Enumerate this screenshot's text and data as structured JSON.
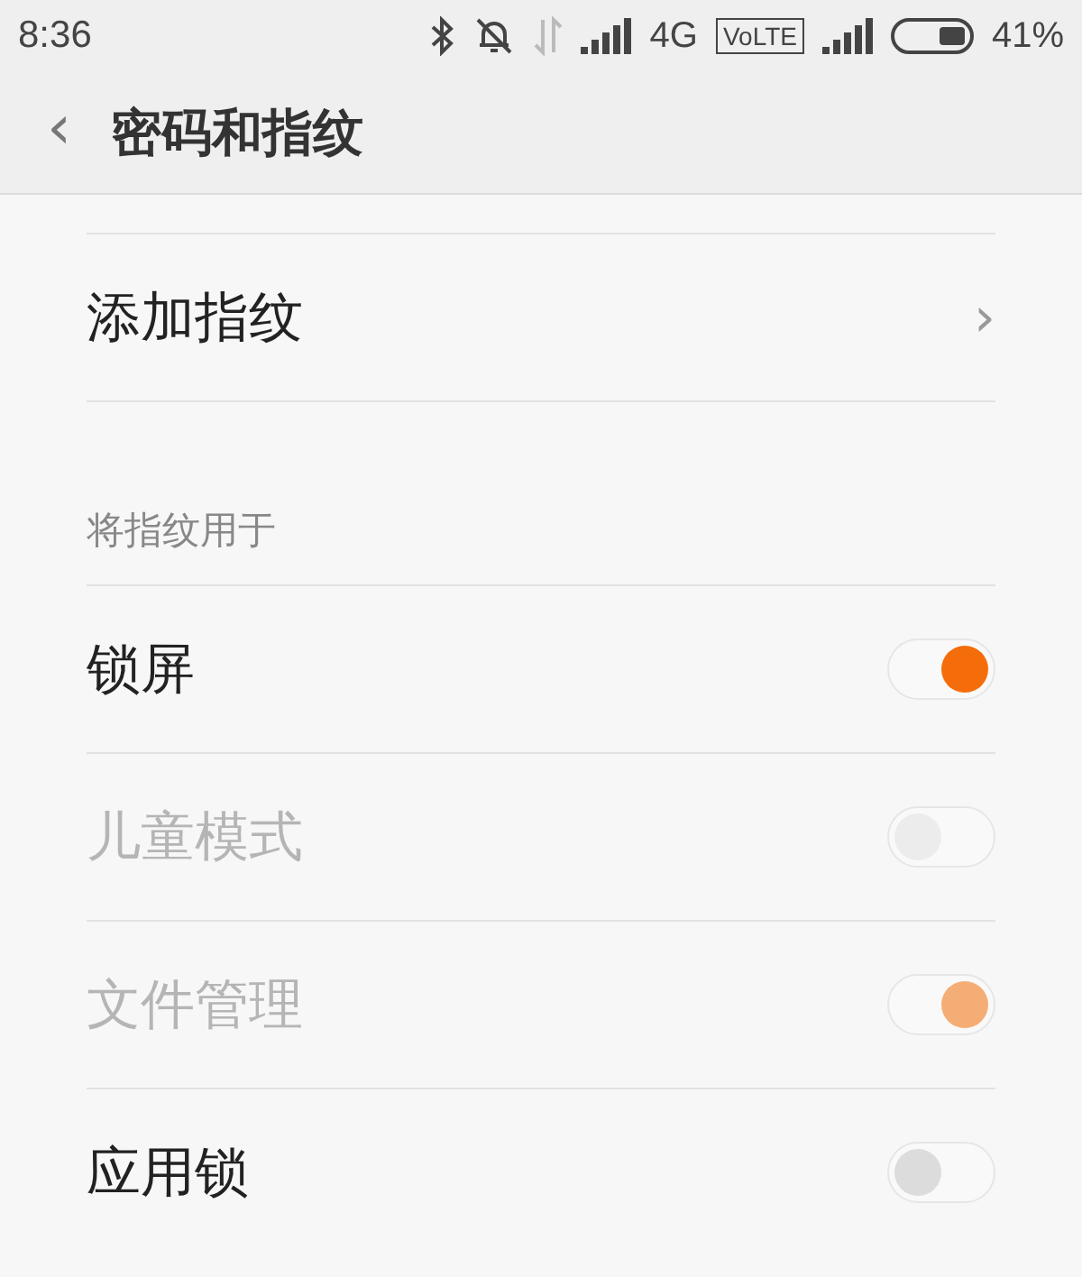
{
  "status_bar": {
    "time": "8:36",
    "network": "4G",
    "volte": "VoLTE",
    "battery": "41%"
  },
  "header": {
    "back": "‹",
    "title": "密码和指纹"
  },
  "add_item": {
    "label": "添加指纹",
    "chevron": "›"
  },
  "section": {
    "title": "将指纹用于"
  },
  "toggles": [
    {
      "label": "锁屏",
      "on": true,
      "disabled": false
    },
    {
      "label": "儿童模式",
      "on": false,
      "disabled": true
    },
    {
      "label": "文件管理",
      "on": true,
      "disabled": true
    },
    {
      "label": "应用锁",
      "on": false,
      "disabled": false
    }
  ]
}
